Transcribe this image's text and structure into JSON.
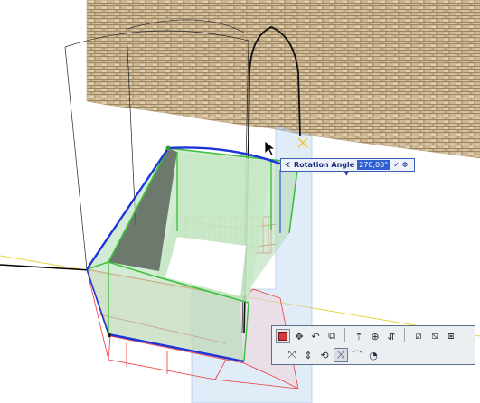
{
  "tracker": {
    "icon": "angle-icon",
    "label": "Rotation Angle",
    "value": "270,00°",
    "confirm": "✓",
    "options": "Φ"
  },
  "palette": {
    "row1": [
      {
        "name": "close-palette",
        "glyph": "■"
      },
      {
        "name": "drag-icon",
        "glyph": "✥"
      },
      {
        "name": "rotate-icon",
        "glyph": "↶"
      },
      {
        "name": "mirror-icon",
        "glyph": "⧉"
      },
      {
        "name": "elevate-icon",
        "glyph": "⇡"
      },
      {
        "name": "multiply-icon",
        "glyph": "⊕"
      },
      {
        "name": "stretch-icon",
        "glyph": "⇵"
      },
      {
        "name": "offset-icon",
        "glyph": "⧄"
      },
      {
        "name": "split-icon",
        "glyph": "⧅"
      },
      {
        "name": "adjust-icon",
        "glyph": "⧆"
      }
    ],
    "row2": [
      {
        "name": "resize-icon",
        "glyph": "⤧"
      },
      {
        "name": "push-pull-icon",
        "glyph": "⇕"
      },
      {
        "name": "rotate-3d-icon",
        "glyph": "⟲"
      },
      {
        "name": "move-node-icon",
        "glyph": "⤨"
      },
      {
        "name": "curve-edge-icon",
        "glyph": "⌒"
      },
      {
        "name": "fillet-icon",
        "glyph": "◔"
      }
    ]
  },
  "colors": {
    "selection_green": "#3ec03e",
    "selection_blue": "#1e34d8",
    "ghost_red": "#ef3a3a",
    "wall_texture": "#cdb693"
  }
}
